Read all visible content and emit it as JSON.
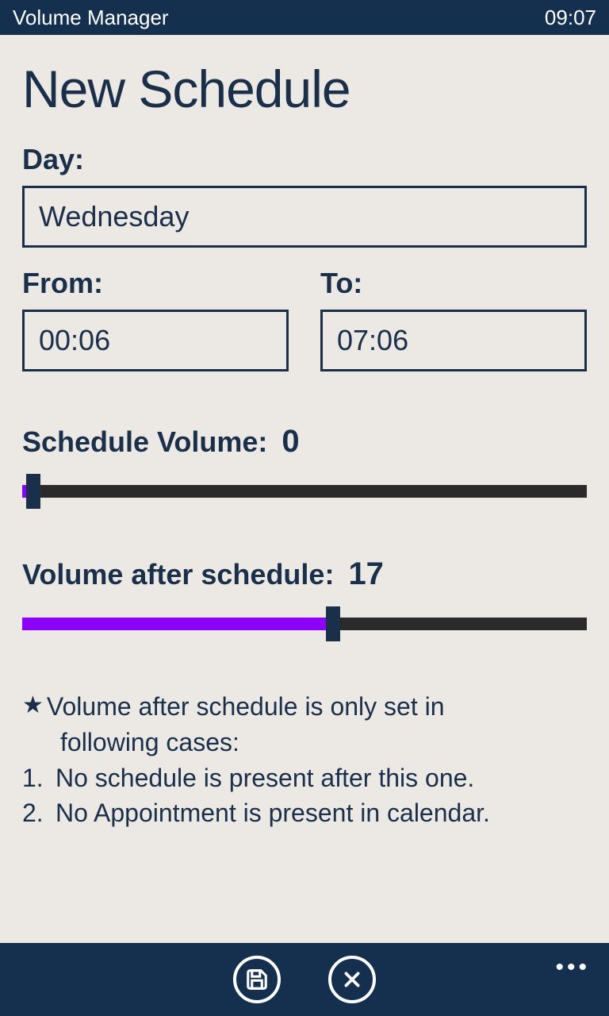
{
  "statusBar": {
    "appName": "Volume Manager",
    "time": "09:07"
  },
  "pageTitle": "New Schedule",
  "dayLabel": "Day:",
  "dayValue": "Wednesday",
  "fromLabel": "From:",
  "fromValue": "00:06",
  "toLabel": "To:",
  "toValue": "07:06",
  "scheduleVolume": {
    "label": "Schedule Volume:",
    "value": "0",
    "percent": 2
  },
  "afterVolume": {
    "label": "Volume after schedule:",
    "value": "17",
    "percent": 55
  },
  "notes": {
    "intro1": "Volume after schedule is only set in",
    "intro2": "following cases:",
    "item1": "No schedule is present after this one.",
    "item2": "No Appointment is present in calendar."
  }
}
